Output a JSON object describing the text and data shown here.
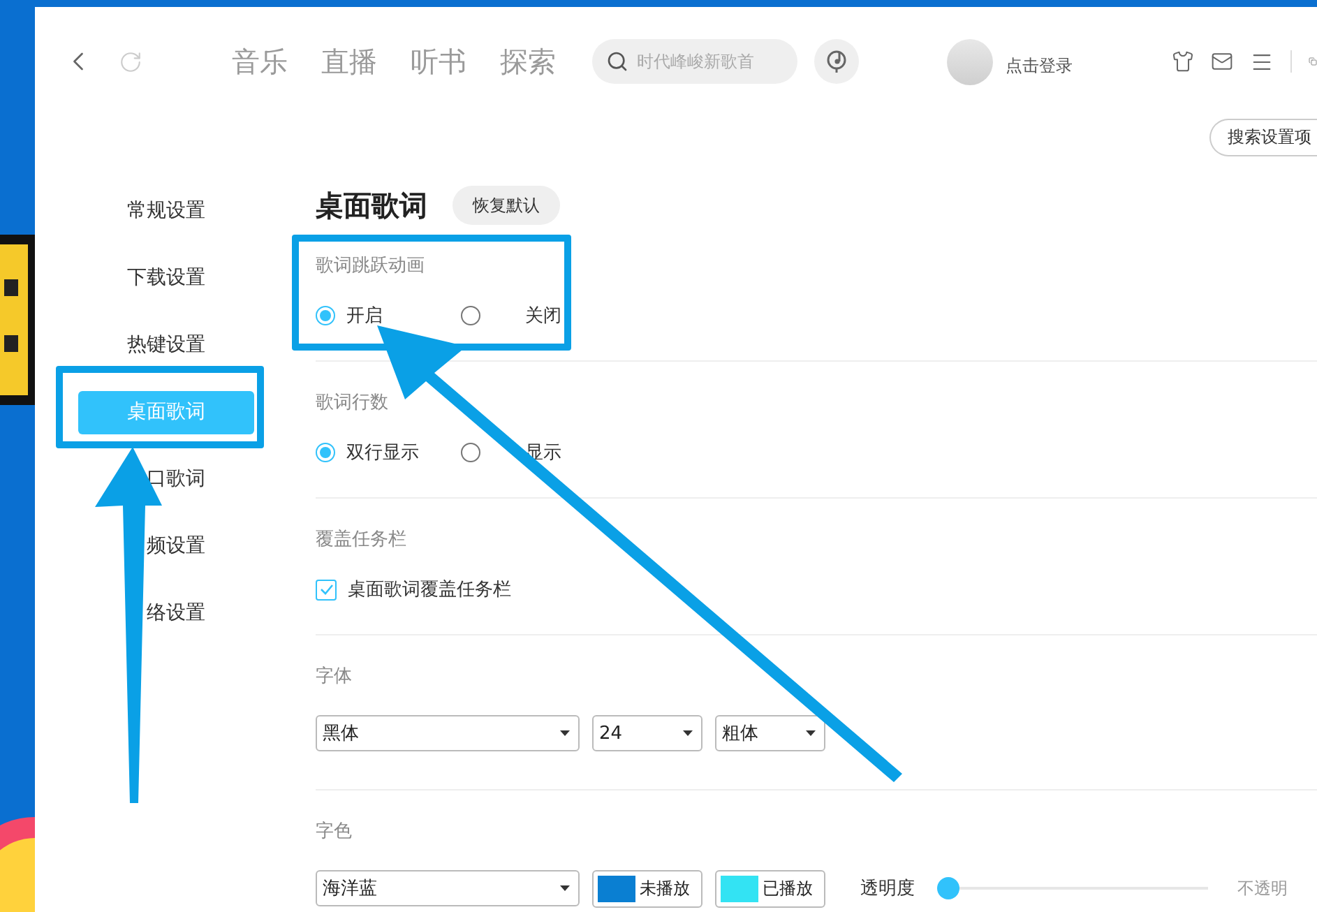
{
  "nav": {
    "tabs": [
      {
        "label": "音乐",
        "selected": false
      },
      {
        "label": "直播",
        "selected": false
      },
      {
        "label": "听书",
        "selected": false
      },
      {
        "label": "探索",
        "selected": false
      }
    ],
    "search": {
      "placeholder": "时代峰峻新歌首"
    },
    "login": "点击登录"
  },
  "search_settings": "搜索设置项",
  "sidebar": {
    "items": [
      {
        "label": "常规设置",
        "selected": false
      },
      {
        "label": "下载设置",
        "selected": false
      },
      {
        "label": "热键设置",
        "selected": false
      },
      {
        "label": "桌面歌词",
        "selected": true
      },
      {
        "label": "口歌词",
        "selected": false
      },
      {
        "label": "频设置",
        "selected": false
      },
      {
        "label": "络设置",
        "selected": false
      }
    ]
  },
  "page": {
    "title": "桌面歌词",
    "reset_button": "恢复默认",
    "sections": [
      {
        "kind": "radio",
        "label": "歌词跳跃动画",
        "options": [
          {
            "label": "开启",
            "selected": true
          },
          {
            "label": "关闭",
            "selected": false
          }
        ]
      },
      {
        "kind": "radio",
        "label": "歌词行数",
        "options": [
          {
            "label": "双行显示",
            "selected": true
          },
          {
            "label": "显示",
            "selected": false
          }
        ]
      },
      {
        "kind": "checkbox",
        "label": "覆盖任务栏",
        "options": [
          {
            "label": "桌面歌词覆盖任务栏",
            "checked": true
          }
        ]
      },
      {
        "kind": "selects",
        "label": "字体",
        "selects": [
          {
            "value": "黑体"
          },
          {
            "value": "24"
          },
          {
            "value": "粗体"
          }
        ]
      },
      {
        "kind": "colors",
        "label": "字色",
        "selects": [
          {
            "value": "海洋蓝"
          }
        ],
        "swatches": [
          {
            "label": "未播放",
            "color": "#0a7fd2"
          },
          {
            "label": "已播放",
            "color": "#33e3f3"
          }
        ],
        "opacity": {
          "label": "透明度",
          "level": 0,
          "end_label": "不透明"
        }
      }
    ]
  }
}
